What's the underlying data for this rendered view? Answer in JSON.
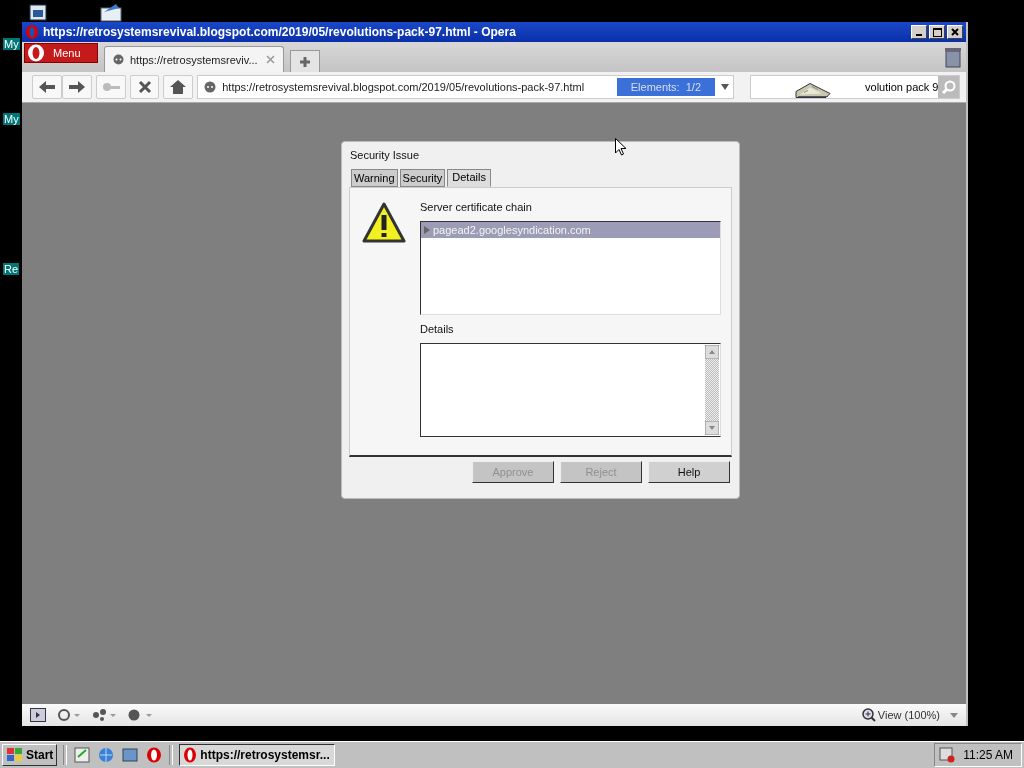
{
  "desktop": {
    "icon_labels": [
      "My",
      "My",
      "Re"
    ]
  },
  "window": {
    "title": "https://retrosystemsrevival.blogspot.com/2019/05/revolutions-pack-97.html - Opera"
  },
  "menu_button": {
    "label": "Menu"
  },
  "tabs": [
    {
      "label": "https://retrosystemsreviv...",
      "selected": true
    }
  ],
  "address_bar": {
    "value": "https://retrosystemsrevival.blogspot.com/2019/05/revolutions-pack-97.html",
    "elements": "Elements:  1/2"
  },
  "search": {
    "value": "volution pack 9"
  },
  "dialog": {
    "title": "Security Issue",
    "tabs": [
      {
        "label": "Warning",
        "selected": false
      },
      {
        "label": "Security",
        "selected": false
      },
      {
        "label": "Details",
        "selected": true
      }
    ],
    "chain_label": "Server certificate chain",
    "chain": [
      {
        "label": "pagead2.googlesyndication.com",
        "selected": true
      }
    ],
    "details_label": "Details",
    "buttons": [
      {
        "label": "Approve",
        "disabled": true
      },
      {
        "label": "Reject",
        "disabled": true
      },
      {
        "label": "Help",
        "disabled": false
      }
    ]
  },
  "status_bar": {
    "zoom": "View (100%)"
  },
  "taskbar": {
    "start": "Start",
    "tasks": [
      {
        "label": "https://retrosystemsr...",
        "selected": true
      }
    ],
    "clock": "11:25 AM"
  }
}
